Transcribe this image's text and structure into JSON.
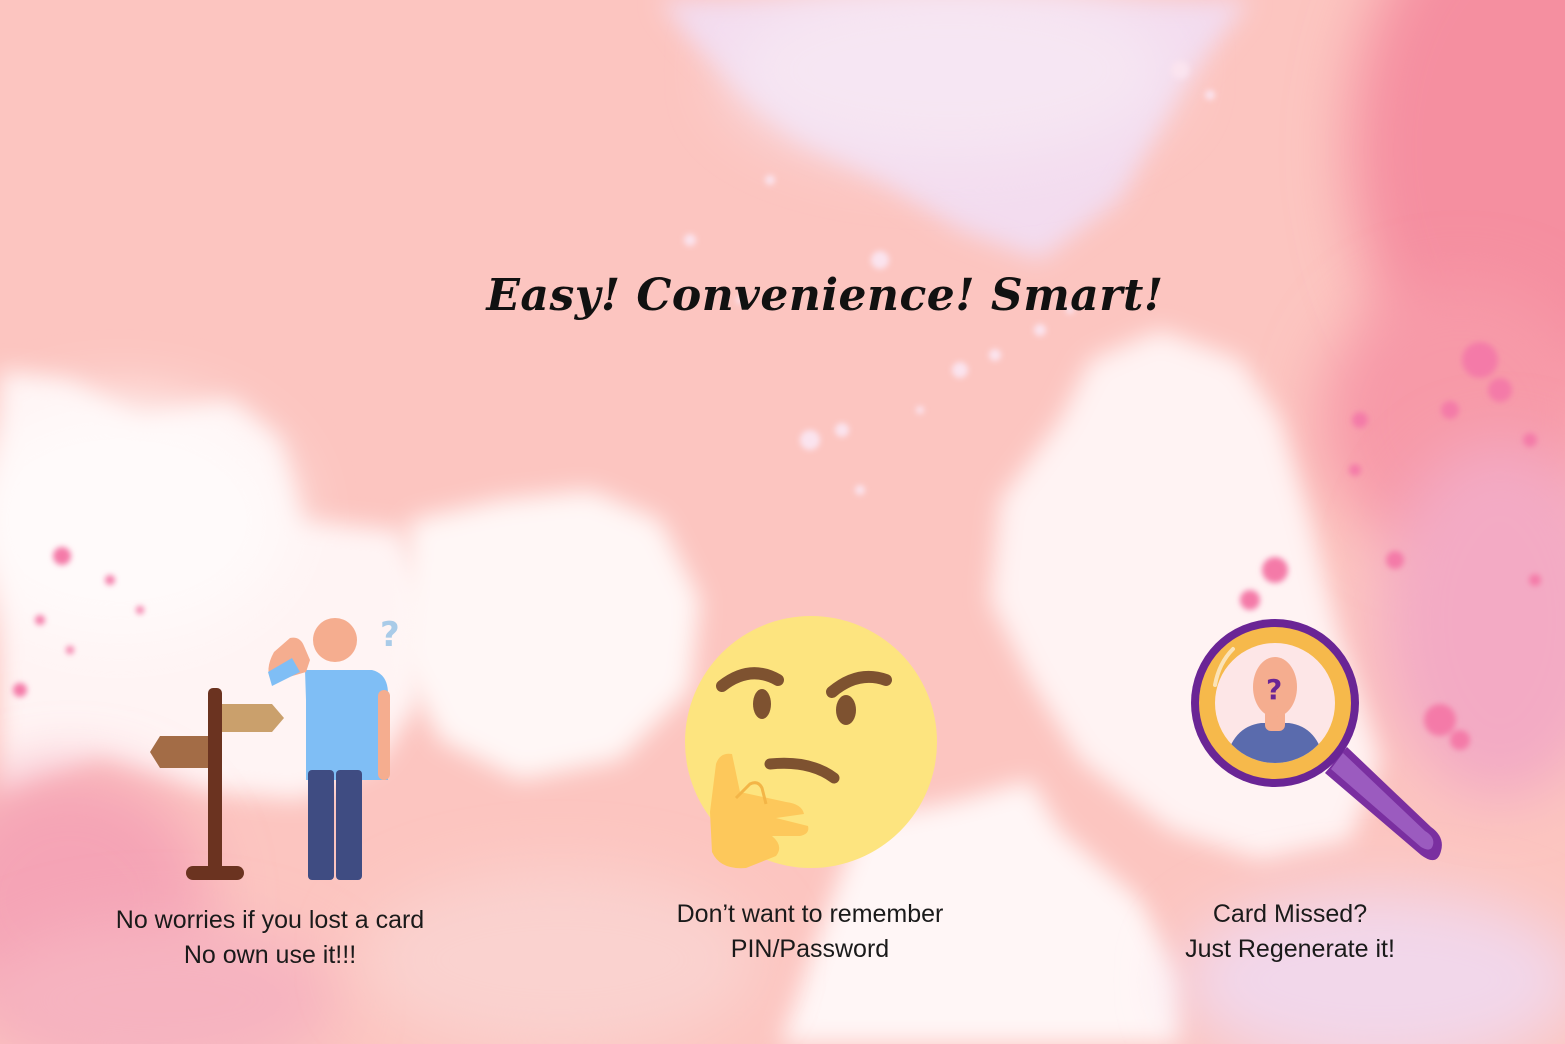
{
  "headline": "Easy! Convenience! Smart!",
  "colors": {
    "background": "#fcc5c0",
    "accent_pink": "#f47aa8",
    "headline_text": "#111111",
    "emoji_yellow": "#fde47f",
    "magnifier_purple": "#7a2fa0"
  },
  "features": [
    {
      "icon": "confused-person-signpost-icon",
      "lines": [
        "No worries if you lost a card",
        "No own use it!!!"
      ]
    },
    {
      "icon": "thinking-face-icon",
      "lines": [
        "Don’t want to remember",
        "PIN/Password"
      ]
    },
    {
      "icon": "magnifier-question-person-icon",
      "lines": [
        "Card Missed?",
        "Just Regenerate it!"
      ]
    }
  ]
}
